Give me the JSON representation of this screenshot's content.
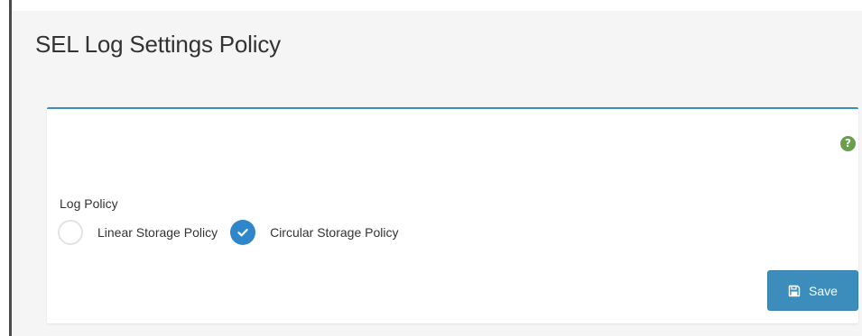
{
  "page": {
    "title": "SEL Log Settings Policy"
  },
  "panel": {
    "help_icon": "question-circle-icon",
    "help_glyph": "?",
    "accent_color": "#3c8dbc"
  },
  "log_policy": {
    "label": "Log Policy",
    "options": [
      {
        "label": "Linear Storage Policy",
        "selected": false
      },
      {
        "label": "Circular Storage Policy",
        "selected": true
      }
    ]
  },
  "actions": {
    "save_label": "Save",
    "save_icon": "floppy-disk-icon"
  },
  "colors": {
    "button": "#3c8dbc",
    "radio_checked": "#2f86c8",
    "help_icon": "#6a9f4a"
  }
}
